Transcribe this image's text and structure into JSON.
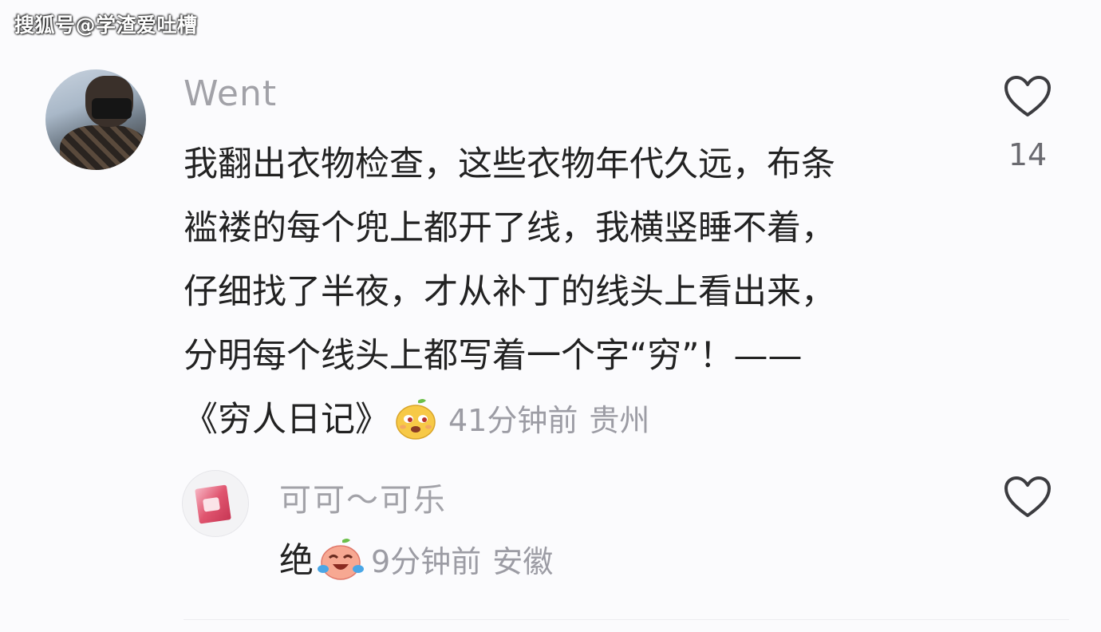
{
  "watermark": "搜狐号@学渣爱吐槽",
  "comments": [
    {
      "username": "Went",
      "lines": [
        "我翻出衣物检查，这些衣物年代久远，布条",
        "褴褛的每个兜上都开了线，我横竖睡不着，",
        "仔细找了半夜，才从补丁的线头上看出来，",
        "分明每个线头上都写着一个字“穷”！——",
        "《穷人日记》"
      ],
      "emoji_icon": "smirk-bean-emoji",
      "time": "41分钟前",
      "location": "贵州",
      "likes": "14"
    },
    {
      "username": "可可～可乐",
      "text": "绝",
      "emoji_icon": "crying-laughing-emoji",
      "time": "9分钟前",
      "location": "安徽"
    }
  ],
  "colors": {
    "background": "#fbfbfd",
    "text": "#222222",
    "meta": "#9c9ca4",
    "emoji_yellow": "#f7c947",
    "emoji_pink": "#f49a8a"
  }
}
